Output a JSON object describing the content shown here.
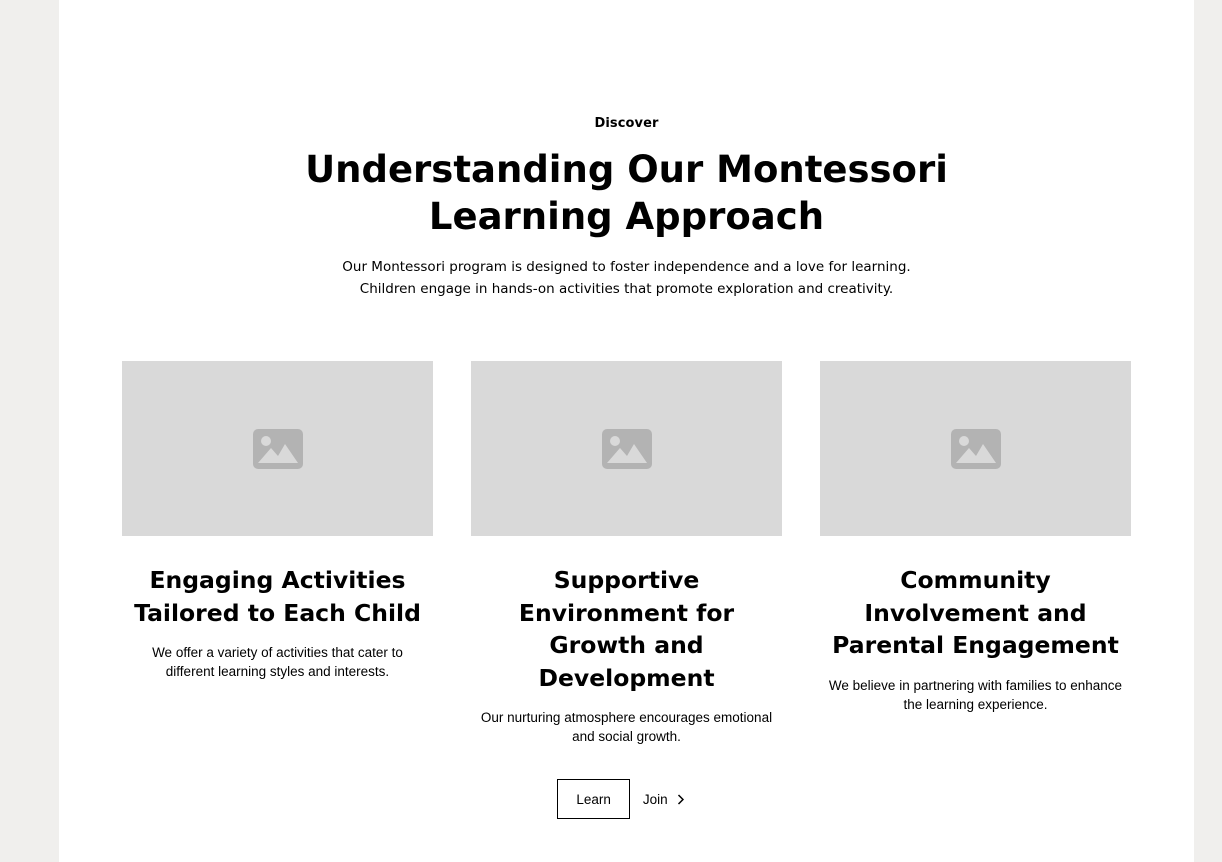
{
  "header": {
    "eyebrow": "Discover",
    "title_line1": "Understanding Our Montessori",
    "title_line2": "Learning Approach",
    "description": "Our Montessori program is designed to foster independence and a love for learning. Children engage in hands-on activities that promote exploration and creativity."
  },
  "cards": [
    {
      "image_icon": "image-placeholder-icon",
      "title": "Engaging Activities Tailored to Each Child",
      "text": "We offer a variety of activities that cater to different learning styles and interests."
    },
    {
      "image_icon": "image-placeholder-icon",
      "title": "Supportive Environment for Growth and Development",
      "text": "Our nurturing atmosphere encourages emotional and social growth."
    },
    {
      "image_icon": "image-placeholder-icon",
      "title": "Community Involvement and Parental Engagement",
      "text": "We believe in partnering with families to enhance the learning experience."
    }
  ],
  "actions": {
    "learn_label": "Learn",
    "join_label": "Join",
    "join_icon": "chevron-right-icon"
  },
  "colors": {
    "outer_background": "#f0efed",
    "page_background": "#ffffff",
    "placeholder": "#d9d9d9",
    "placeholder_icon": "#b3b3b3",
    "text": "#000000"
  }
}
